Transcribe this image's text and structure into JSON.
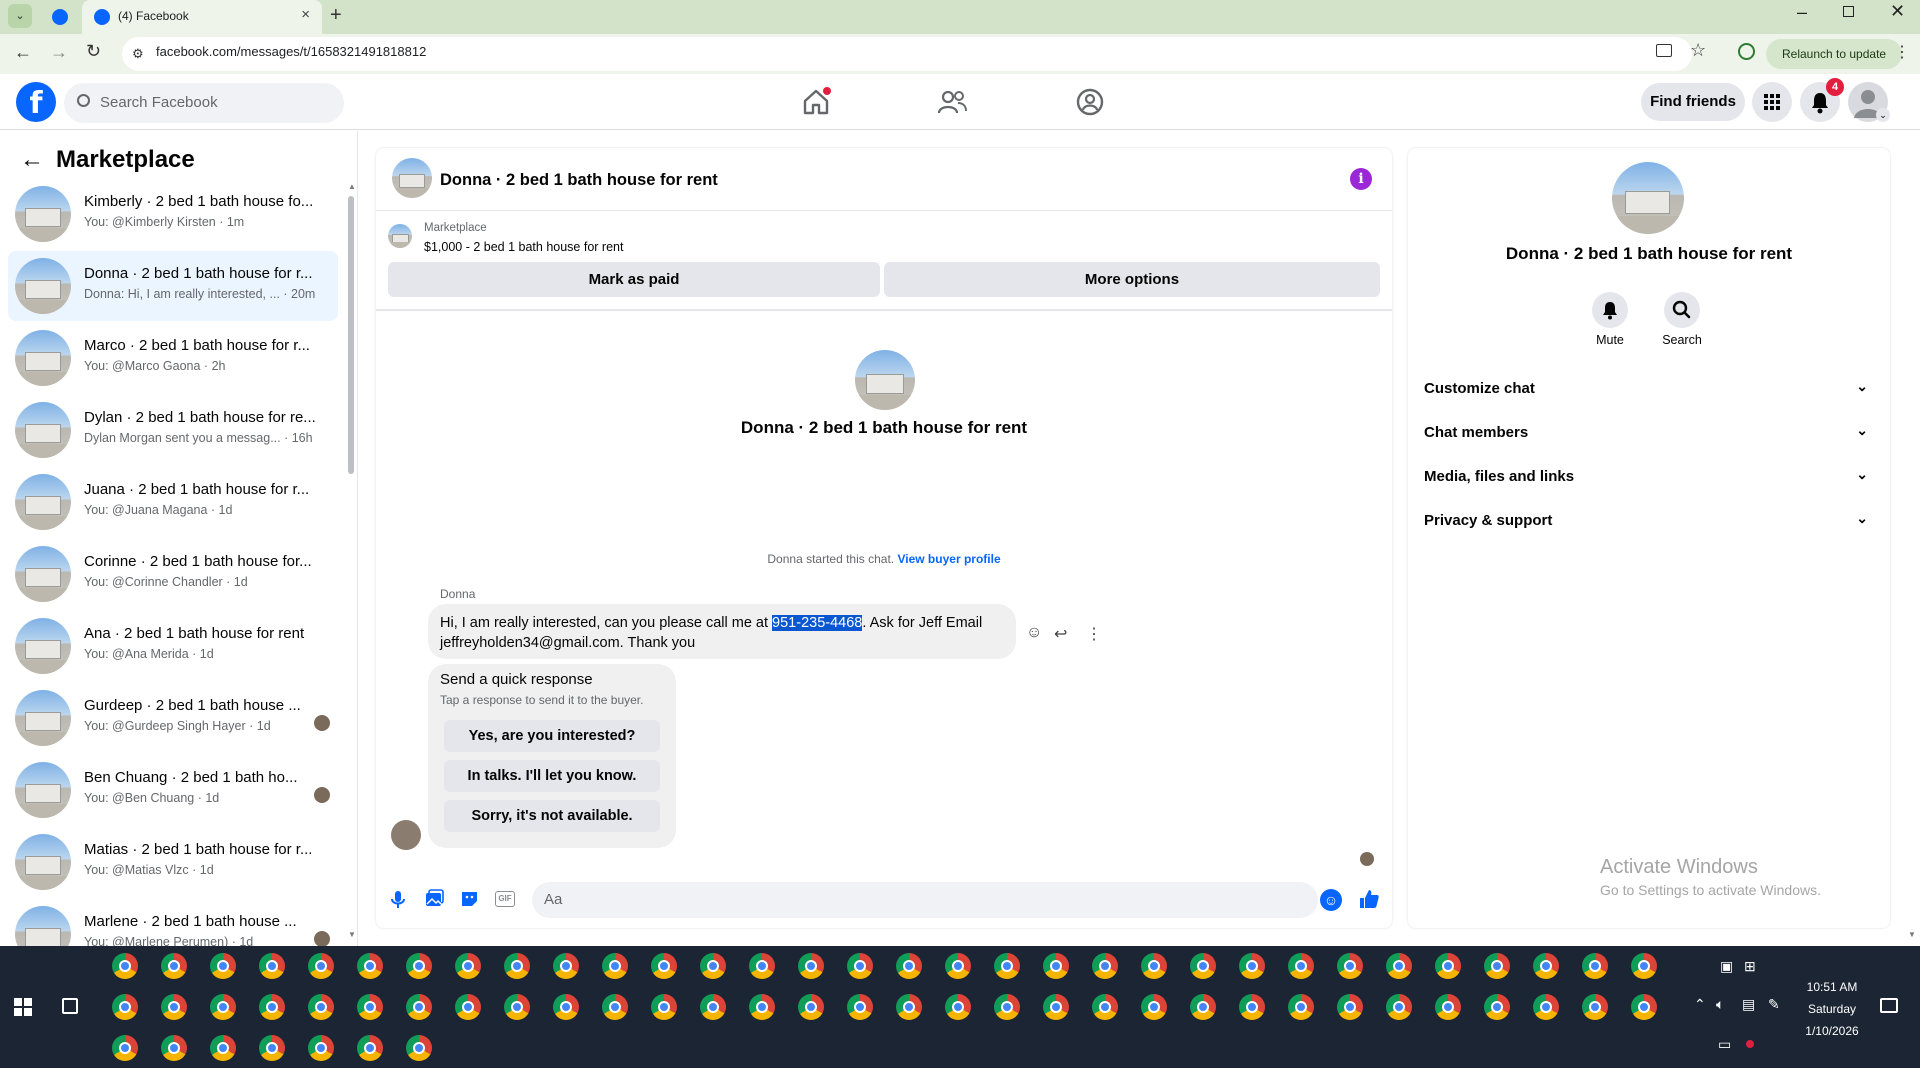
{
  "browser": {
    "tab_title": "(4) Facebook",
    "url": "facebook.com/messages/t/1658321491818812",
    "relaunch_label": "Relaunch to update"
  },
  "fb": {
    "search_placeholder": "Search Facebook",
    "find_friends": "Find friends",
    "notification_count": "4"
  },
  "sidebar": {
    "title": "Marketplace",
    "conversations": [
      {
        "name": "Kimberly · 2 bed 1 bath house fo...",
        "preview": "You: @Kimberly Kirsten · 1m"
      },
      {
        "name": "Donna · 2 bed 1 bath house for r...",
        "preview": "Donna: Hi, I am really interested, ... · 20m"
      },
      {
        "name": "Marco · 2 bed 1 bath house for r...",
        "preview": "You: @Marco Gaona · 2h"
      },
      {
        "name": "Dylan · 2 bed 1 bath house for re...",
        "preview": "Dylan Morgan sent you a messag... · 16h"
      },
      {
        "name": "Juana · 2 bed 1 bath house for r...",
        "preview": "You: @Juana Magana · 1d"
      },
      {
        "name": "Corinne · 2 bed 1 bath house for...",
        "preview": "You: @Corinne Chandler · 1d"
      },
      {
        "name": "Ana · 2 bed 1 bath house for rent",
        "preview": "You: @Ana Merida · 1d"
      },
      {
        "name": "Gurdeep · 2 bed 1 bath house ...",
        "preview": "You: @Gurdeep Singh Hayer · 1d"
      },
      {
        "name": "Ben Chuang · 2 bed 1 bath ho...",
        "preview": "You: @Ben Chuang · 1d"
      },
      {
        "name": "Matias · 2 bed 1 bath house for r...",
        "preview": "You: @Matias Vlzc · 1d"
      },
      {
        "name": "Marlene · 2 bed 1 bath house ...",
        "preview": "You: @Marlene Perumen) · 1d"
      }
    ]
  },
  "chat": {
    "header_title": "Donna · 2 bed 1 bath house for rent",
    "marketplace_label": "Marketplace",
    "item_label": "$1,000 - 2 bed 1 bath house for rent",
    "mark_paid": "Mark as paid",
    "more_options": "More options",
    "intro_name": "Donna · 2 bed 1 bath house for rent",
    "started_text": "Donna started this chat.",
    "view_buyer": "View buyer profile",
    "sender": "Donna",
    "msg_part1": "Hi, I am really interested, can you please call me at ",
    "msg_phone": "951-235-4468",
    "msg_part2": ".  Ask for Jeff  Email",
    "msg_line2": "jeffreyholden34@gmail.com.  Thank you",
    "quick_title": "Send a quick response",
    "quick_sub": "Tap a response to send it to the buyer.",
    "quick_options": [
      "Yes, are you interested?",
      "In talks. I'll let you know.",
      "Sorry, it's not available."
    ],
    "compose_placeholder": "Aa"
  },
  "details": {
    "name": "Donna · 2 bed 1 bath house for rent",
    "mute": "Mute",
    "search": "Search",
    "sections": [
      "Customize chat",
      "Chat members",
      "Media, files and links",
      "Privacy & support"
    ]
  },
  "watermark": {
    "line1": "Activate Windows",
    "line2": "Go to Settings to activate Windows."
  },
  "taskbar": {
    "time": "10:51 AM",
    "day": "Saturday",
    "date": "1/10/2026"
  },
  "colors": {
    "fb_blue": "#0866ff",
    "selected_row": "#ebf5ff",
    "highlight": "#0b57d0"
  }
}
